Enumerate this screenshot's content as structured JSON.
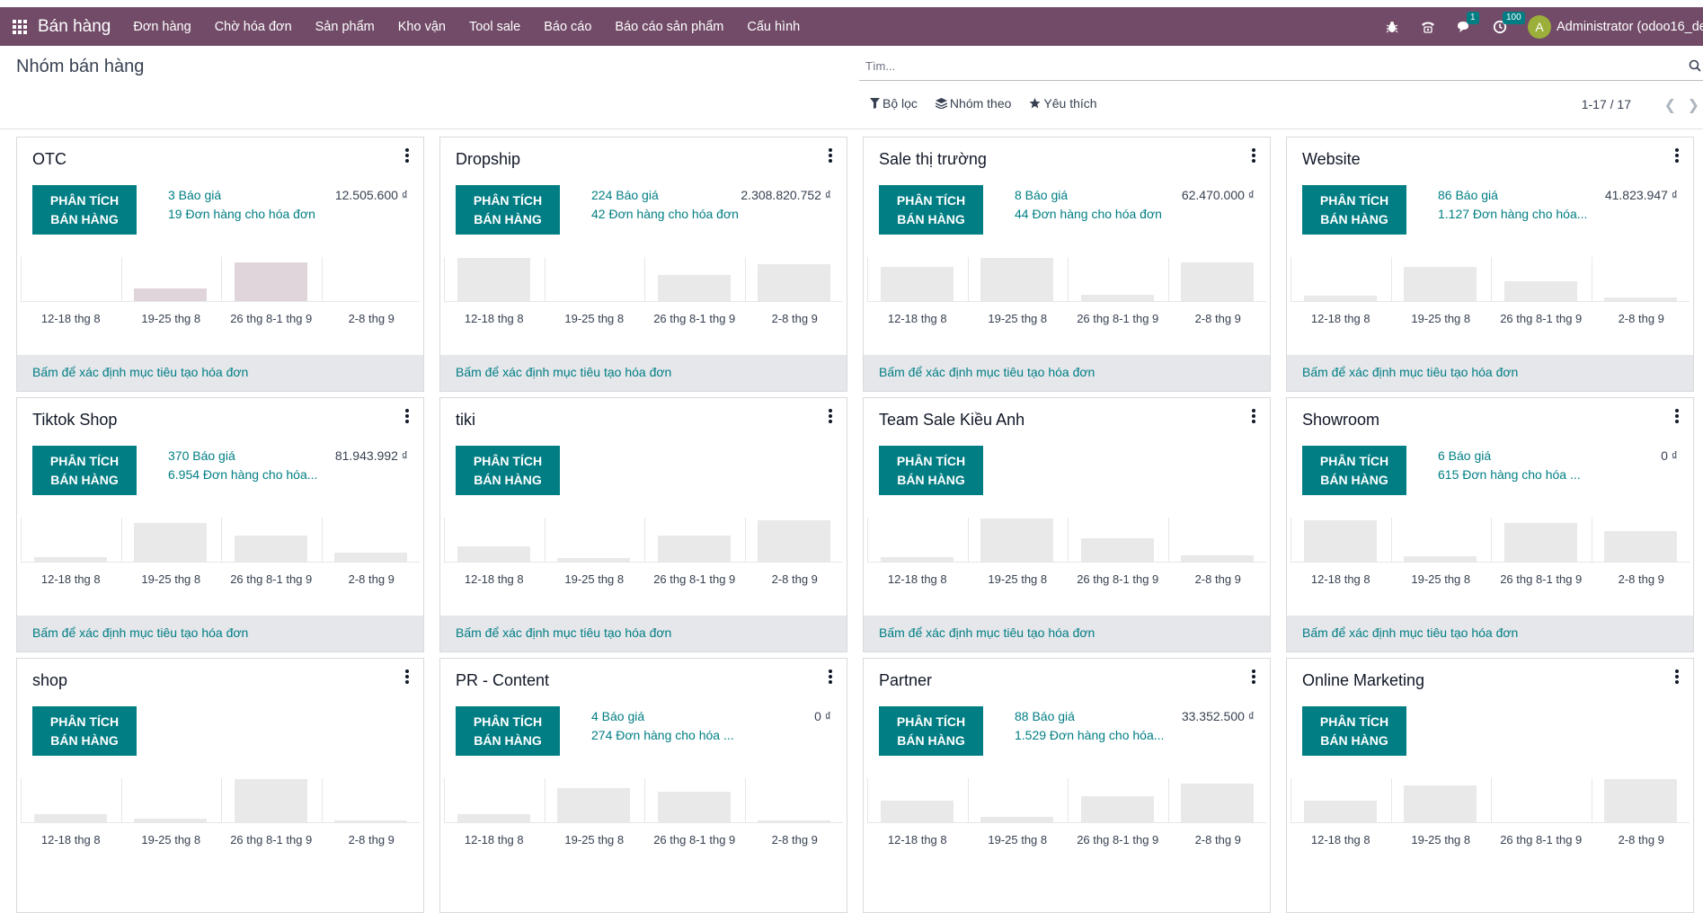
{
  "nav": {
    "app_name": "Bán hàng",
    "menu": [
      "Đơn hàng",
      "Chờ hóa đơn",
      "Sản phẩm",
      "Kho vận",
      "Tool sale",
      "Báo cáo",
      "Báo cáo sản phẩm",
      "Cấu hình"
    ],
    "messages_badge": "1",
    "activities_badge": "100",
    "avatar_letter": "A",
    "user": "Administrator (odoo16_de"
  },
  "control": {
    "breadcrumb": "Nhóm bán hàng",
    "search_placeholder": "Tìm...",
    "filter_label": "Bộ lọc",
    "groupby_label": "Nhóm theo",
    "favorites_label": "Yêu thích",
    "pager": "1-17 / 17"
  },
  "chart_labels": [
    "12-18 thg 8",
    "19-25 thg 8",
    "26 thg 8-1 thg 9",
    "2-8 thg 9"
  ],
  "analyse_label_line1": "PHÂN TÍCH",
  "analyse_label_line2": "BÁN HÀNG",
  "footer_text": "Bấm để xác định mục tiêu tạo hóa đơn",
  "cards": [
    {
      "name": "OTC",
      "quotes": "3 Báo giá",
      "orders": "19 Đơn hàng cho hóa đơn",
      "amount": "12.505.600 ₫",
      "bars": [
        0,
        0.3,
        0.9,
        0
      ],
      "highlight": true,
      "footer": true
    },
    {
      "name": "Dropship",
      "quotes": "224 Báo giá",
      "orders": "42 Đơn hàng cho hóa đơn",
      "amount": "2.308.820.752 ₫",
      "bars": [
        1,
        0,
        0.6,
        0.85
      ],
      "highlight": false,
      "footer": true
    },
    {
      "name": "Sale thị trường",
      "quotes": "8 Báo giá",
      "orders": "44 Đơn hàng cho hóa đơn",
      "amount": "62.470.000 ₫",
      "bars": [
        0.8,
        1,
        0.15,
        0.9
      ],
      "highlight": false,
      "footer": true
    },
    {
      "name": "Website",
      "quotes": "86 Báo giá",
      "orders": "1.127 Đơn hàng cho hóa...",
      "amount": "41.823.947 ₫",
      "bars": [
        0.12,
        0.8,
        0.45,
        0.08
      ],
      "highlight": false,
      "footer": true
    },
    {
      "name": "Tiktok Shop",
      "quotes": "370 Báo giá",
      "orders": "6.954 Đơn hàng cho hóa...",
      "amount": "81.943.992 ₫",
      "bars": [
        0.1,
        0.9,
        0.6,
        0.2
      ],
      "highlight": false,
      "footer": true
    },
    {
      "name": "tiki",
      "quotes": "",
      "orders": "",
      "amount": "",
      "bars": [
        0.35,
        0.08,
        0.6,
        0.95
      ],
      "highlight": false,
      "footer": true
    },
    {
      "name": "Team Sale Kiều Anh",
      "quotes": "",
      "orders": "",
      "amount": "",
      "bars": [
        0.1,
        1,
        0.55,
        0.15
      ],
      "highlight": false,
      "footer": true
    },
    {
      "name": "Showroom",
      "quotes": "6 Báo giá",
      "orders": "615 Đơn hàng cho hóa ...",
      "amount": "0 ₫",
      "bars": [
        0.95,
        0.12,
        0.9,
        0.7
      ],
      "highlight": false,
      "footer": true
    },
    {
      "name": "shop",
      "quotes": "",
      "orders": "",
      "amount": "",
      "bars": [
        0.18,
        0.08,
        1,
        0.05
      ],
      "highlight": false,
      "footer": false
    },
    {
      "name": "PR - Content",
      "quotes": "4 Báo giá",
      "orders": "274 Đơn hàng cho hóa ...",
      "amount": "0 ₫",
      "bars": [
        0.18,
        0.8,
        0.7,
        0.04
      ],
      "highlight": false,
      "footer": false
    },
    {
      "name": "Partner",
      "quotes": "88 Báo giá",
      "orders": "1.529 Đơn hàng cho hóa...",
      "amount": "33.352.500 ₫",
      "bars": [
        0.5,
        0.12,
        0.6,
        0.9
      ],
      "highlight": false,
      "footer": false
    },
    {
      "name": "Online Marketing",
      "quotes": "",
      "orders": "",
      "amount": "",
      "bars": [
        0.5,
        0.85,
        0,
        1
      ],
      "highlight": false,
      "footer": false
    }
  ]
}
